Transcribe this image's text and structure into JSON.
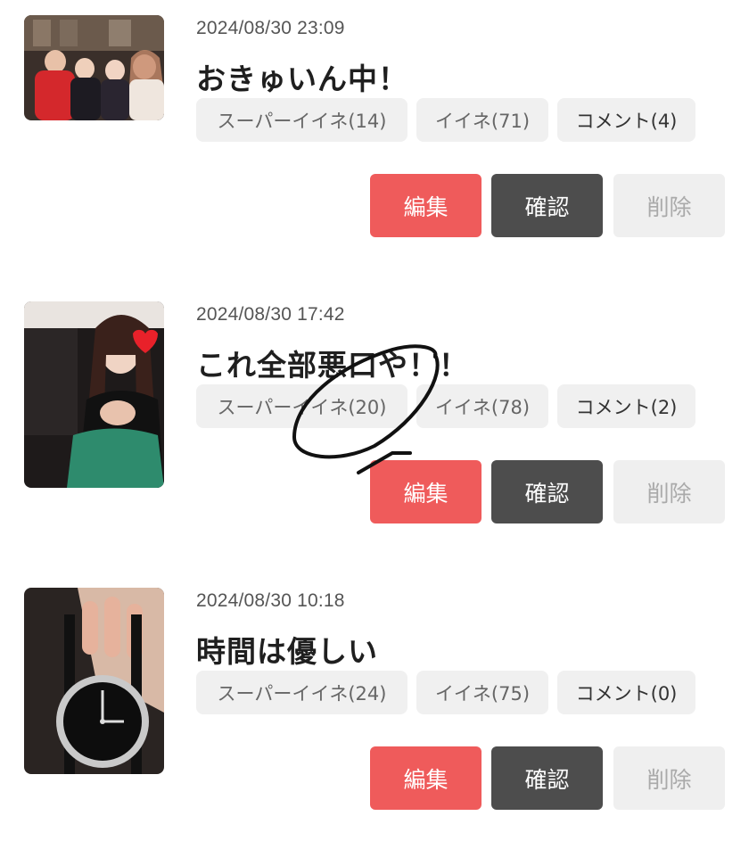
{
  "posts": [
    {
      "date": "2024/08/30 23:09",
      "title": "おきゅいん中！",
      "super_like": "スーパーイイネ(14)",
      "like": "イイネ(71)",
      "comment": "コメント(4)",
      "edit": "編集",
      "confirm": "確認",
      "delete": "削除"
    },
    {
      "date": "2024/08/30 17:42",
      "title": "これ全部悪口や！！",
      "super_like": "スーパーイイネ(20)",
      "like": "イイネ(78)",
      "comment": "コメント(2)",
      "edit": "編集",
      "confirm": "確認",
      "delete": "削除"
    },
    {
      "date": "2024/08/30 10:18",
      "title": "時間は優しい",
      "super_like": "スーパーイイネ(24)",
      "like": "イイネ(75)",
      "comment": "コメント(0)",
      "edit": "編集",
      "confirm": "確認",
      "delete": "削除"
    }
  ],
  "colors": {
    "edit_button": "#ef5b5b",
    "confirm_button": "#4d4d4d",
    "delete_button": "#efefef",
    "chip_background": "#f0f0f0"
  }
}
